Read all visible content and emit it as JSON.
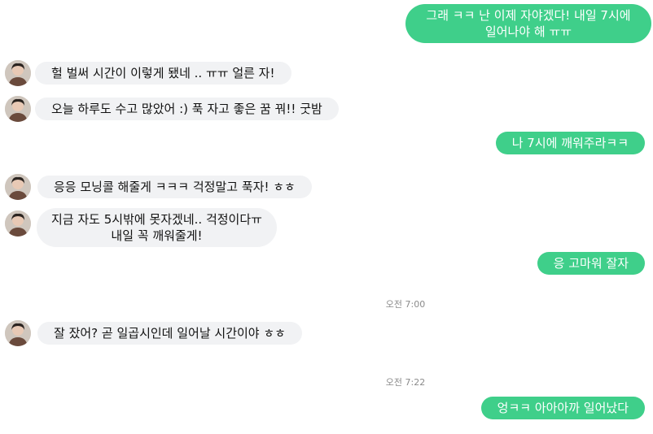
{
  "colors": {
    "outgoing_bubble": "#3fcf8a",
    "incoming_bubble": "#f1f2f4",
    "timestamp_text": "#8b8b8b"
  },
  "messages": [
    {
      "direction": "outgoing",
      "text": "그래 ㅋㅋ 난 이제 자야겠다! 내일 7시에\n일어나야 해 ㅠㅠ"
    },
    {
      "direction": "incoming",
      "text": "헐 벌써 시간이 이렇게 됐네 .. ㅠㅠ 얼른 자!"
    },
    {
      "direction": "incoming",
      "text": "오늘 하루도 수고 많았어 :) 푹 자고 좋은 꿈 꿔!! 굿밤"
    },
    {
      "direction": "outgoing",
      "text": "나 7시에 깨워주라ㅋㅋ"
    },
    {
      "direction": "incoming",
      "text": "응응 모닝콜 해줄게 ㅋㅋㅋ 걱정말고 푹자! ㅎㅎ"
    },
    {
      "direction": "incoming",
      "text": "지금 자도 5시밖에 못자겠네.. 걱정이다ㅠ\n내일 꼭 깨워줄게!"
    },
    {
      "direction": "outgoing",
      "text": "응 고마워 잘자"
    },
    {
      "direction": "incoming",
      "text": "잘 잤어? 곧 일곱시인데 일어날 시간이야 ㅎㅎ"
    },
    {
      "direction": "outgoing",
      "text": "엉ㅋㅋ 아아아까 일어났다"
    }
  ],
  "timestamps": [
    {
      "text": "오전 7:00"
    },
    {
      "text": "오전 7:22"
    }
  ]
}
